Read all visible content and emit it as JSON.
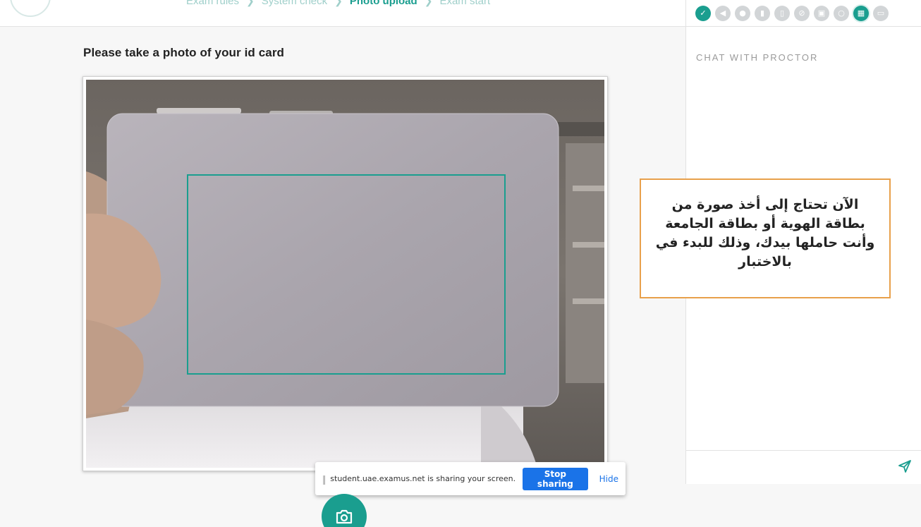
{
  "steps": {
    "items": [
      "Exam rules",
      "System check",
      "Photo upload",
      "Exam start"
    ],
    "active_index": 2
  },
  "main": {
    "heading": "Please take a photo of your id card"
  },
  "share_bar": {
    "message": "student.uae.examus.net is sharing your screen.",
    "stop_label": "Stop sharing",
    "hide_label": "Hide"
  },
  "right_panel": {
    "chat_title": "CHAT WITH PROCTOR",
    "toolbar_icons": [
      "check-icon",
      "megaphone-icon",
      "person-icon",
      "book-icon",
      "device-icon",
      "eye-off-icon",
      "window-icon",
      "headset-icon",
      "qr-icon",
      "chat-bubble-icon"
    ]
  },
  "callout": {
    "text": "الآن تحتاج إلى أخذ صورة من بطاقة الهوية أو بطاقة الجامعة وأنت حاملها بيدك، وذلك للبدء في بالاختبار"
  },
  "colors": {
    "accent": "#1a9e8f",
    "callout_border": "#e8a04b",
    "stop_button": "#1a73e8"
  }
}
